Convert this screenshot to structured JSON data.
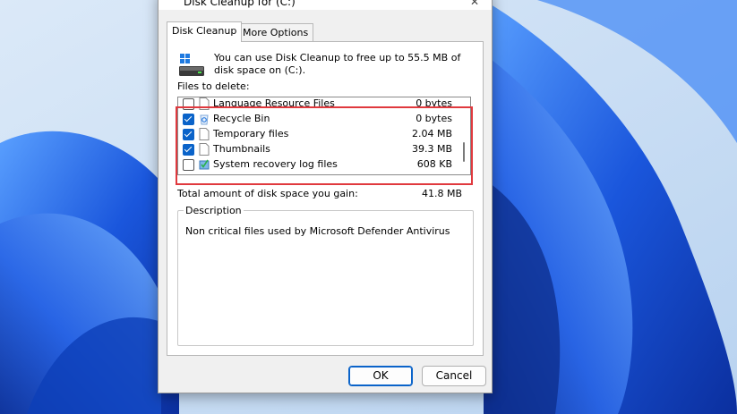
{
  "window": {
    "title": "Disk Cleanup for  (C:)",
    "close_glyph": "✕"
  },
  "tabs": [
    {
      "label": "Disk Cleanup"
    },
    {
      "label": "More Options"
    }
  ],
  "intro_text": "You can use Disk Cleanup to free up to 55.5 MB of disk space on  (C:).",
  "files_label": "Files to delete:",
  "files": [
    {
      "name": "Language Resource Files",
      "size": "0 bytes",
      "checked": false,
      "icon": "file-icon"
    },
    {
      "name": "Recycle Bin",
      "size": "0 bytes",
      "checked": true,
      "icon": "recycle-bin-icon"
    },
    {
      "name": "Temporary files",
      "size": "2.04 MB",
      "checked": true,
      "icon": "file-icon"
    },
    {
      "name": "Thumbnails",
      "size": "39.3 MB",
      "checked": true,
      "icon": "file-icon"
    },
    {
      "name": "System recovery log files",
      "size": "608 KB",
      "checked": false,
      "icon": "recovery-log-icon"
    }
  ],
  "total": {
    "label": "Total amount of disk space you gain:",
    "value": "41.8 MB"
  },
  "description": {
    "legend": "Description",
    "text": "Non critical files used by Microsoft Defender Antivirus"
  },
  "buttons": {
    "ok": "OK",
    "cancel": "Cancel"
  },
  "colors": {
    "accent": "#0a63c9",
    "highlight": "#e0393e",
    "wallpaper": "#1c5fe0"
  }
}
